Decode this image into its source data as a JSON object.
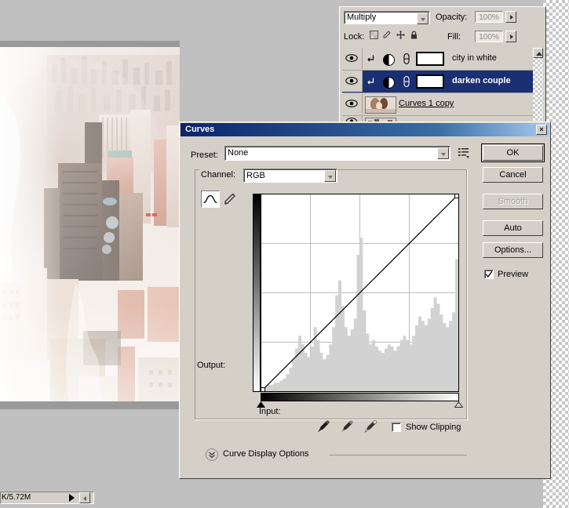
{
  "app": {
    "background_color": "#c0c0c0"
  },
  "layers_panel": {
    "blend_mode": "Multiply",
    "opacity_label": "Opacity:",
    "opacity_value": "100%",
    "lock_label": "Lock:",
    "fill_label": "Fill:",
    "fill_value": "100%",
    "lock_icons": [
      "lock-transparency-icon",
      "lock-image-icon",
      "lock-position-icon",
      "lock-all-icon"
    ],
    "layers": [
      {
        "name": "city in white",
        "selected": false,
        "type": "adjustment",
        "clipped": true,
        "visible": true,
        "thumb": "white-mask"
      },
      {
        "name": "darken couple",
        "selected": true,
        "type": "adjustment",
        "clipped": true,
        "visible": true,
        "thumb": "white-mask"
      },
      {
        "name": "Curves 1 copy",
        "selected": false,
        "type": "pixel",
        "clipped": false,
        "visible": true,
        "thumb": "photo-couple"
      }
    ]
  },
  "curves_dialog": {
    "title": "Curves",
    "close_label": "×",
    "preset_label": "Preset:",
    "preset_value": "None",
    "channel_label": "Channel:",
    "channel_value": "RGB",
    "output_label": "Output:",
    "input_label": "Input:",
    "show_clipping_label": "Show Clipping",
    "show_clipping_checked": false,
    "preview_label": "Preview",
    "preview_checked": true,
    "curve_display_options_label": "Curve Display Options",
    "buttons": [
      {
        "label": "OK",
        "state": "default"
      },
      {
        "label": "Cancel",
        "state": "normal"
      },
      {
        "label": "Smooth",
        "state": "disabled"
      },
      {
        "label": "Auto",
        "state": "normal"
      },
      {
        "label": "Options...",
        "state": "normal"
      }
    ],
    "tools": [
      "curve-tool-icon",
      "pencil-tool-icon"
    ],
    "eyedroppers": [
      "black-point-eyedropper",
      "gray-point-eyedropper",
      "white-point-eyedropper"
    ],
    "preset_menu_icon": "preset-options-menu-icon"
  },
  "chart_data": {
    "type": "line",
    "title": "Curves",
    "xlabel": "Input",
    "ylabel": "Output",
    "xlim": [
      0,
      255
    ],
    "ylim": [
      0,
      255
    ],
    "grid": true,
    "grid_divisions": 4,
    "series": [
      {
        "name": "RGB curve",
        "x": [
          0,
          255
        ],
        "values": [
          0,
          255
        ],
        "control_points": [
          [
            0,
            0
          ],
          [
            255,
            255
          ]
        ]
      }
    ],
    "histogram": {
      "name": "Image histogram",
      "bins": 64,
      "values": [
        2,
        2,
        3,
        3,
        4,
        4,
        5,
        6,
        8,
        11,
        15,
        20,
        26,
        22,
        18,
        16,
        21,
        30,
        24,
        18,
        15,
        17,
        22,
        30,
        45,
        52,
        40,
        30,
        26,
        29,
        34,
        64,
        72,
        38,
        27,
        22,
        24,
        21,
        19,
        18,
        20,
        22,
        21,
        19,
        21,
        24,
        26,
        24,
        22,
        26,
        31,
        35,
        33,
        31,
        34,
        39,
        44,
        41,
        36,
        32,
        30,
        33,
        37,
        62
      ]
    }
  },
  "status_bar": {
    "text": "K/5.72M"
  }
}
